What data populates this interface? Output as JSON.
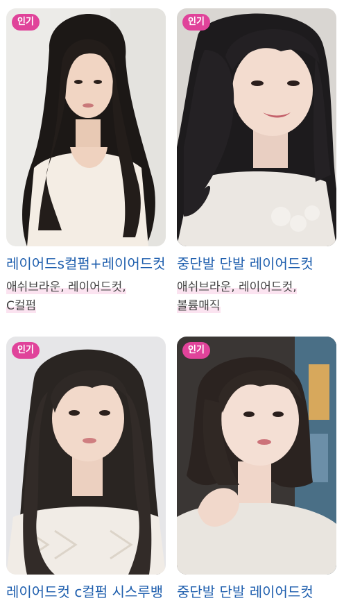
{
  "colors": {
    "accent": "#e0439a",
    "title": "#1f5fae",
    "tag_text": "#444444",
    "tag_highlight": "#fbe3f0"
  },
  "cards": [
    {
      "badge": "인기",
      "title": "레이어드s컬펌+레이어드컷",
      "tags_line1": "애쉬브라운, 레이어드컷,",
      "tags_line2": "C컬펌",
      "image": "woman-long-layered-black-hair-photo"
    },
    {
      "badge": "인기",
      "title": "중단발 단발 레이어드컷",
      "tags_line1": "애쉬브라운, 레이어드컷,",
      "tags_line2": "볼륨매직",
      "image": "woman-medium-layered-hair-with-bangs-photo"
    },
    {
      "badge": "인기",
      "title": "레이어드컷 c컬펌 시스루뱅",
      "tags_line1": "",
      "tags_line2": "",
      "image": "woman-long-layered-hair-curtain-bangs-photo"
    },
    {
      "badge": "인기",
      "title": "중단발 단발 레이어드컷",
      "tags_line1": "",
      "tags_line2": "",
      "image": "woman-bob-hair-photo"
    }
  ]
}
